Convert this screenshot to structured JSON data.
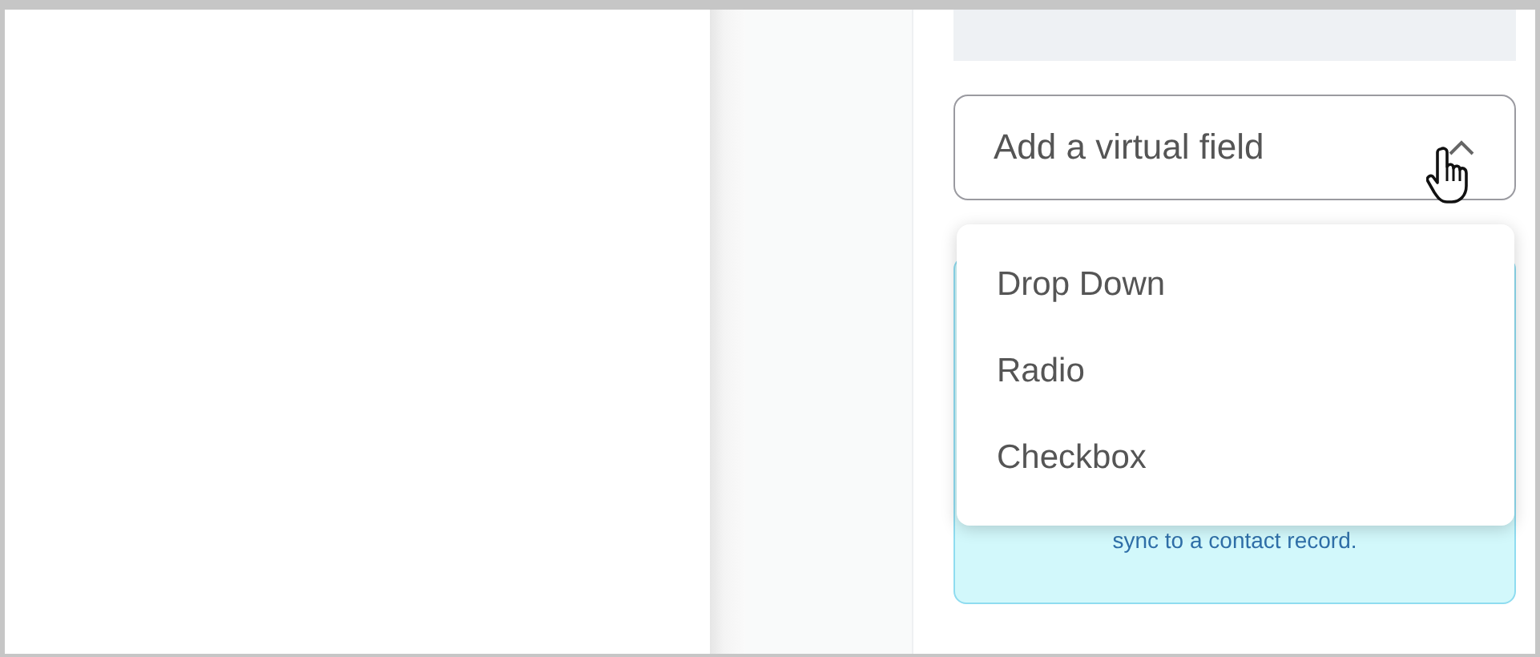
{
  "field": {
    "placeholder": "Add a virtual field",
    "expanded": true
  },
  "menu": {
    "items": [
      {
        "label": "Drop Down"
      },
      {
        "label": "Radio"
      },
      {
        "label": "Checkbox"
      }
    ]
  },
  "info": {
    "text": "sync to a contact record."
  }
}
